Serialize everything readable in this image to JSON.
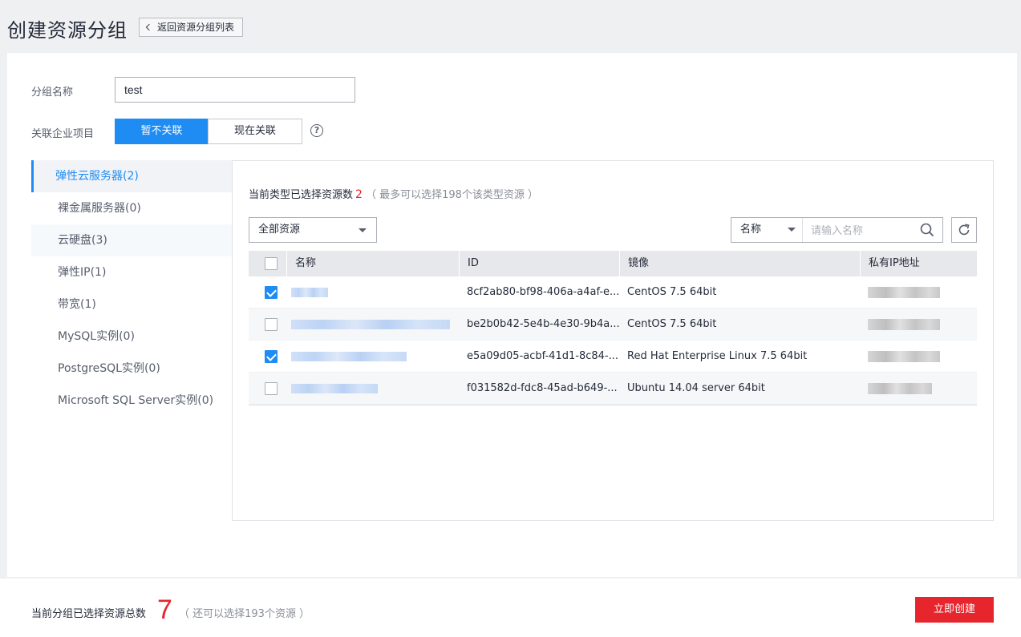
{
  "header": {
    "title": "创建资源分组",
    "back_label": "返回资源分组列表"
  },
  "form": {
    "group_name_label": "分组名称",
    "group_name_value": "test",
    "project_label": "关联企业项目",
    "project_options": [
      "暂不关联",
      "现在关联"
    ],
    "project_selected": "暂不关联"
  },
  "sidebar": {
    "items": [
      {
        "label": "弹性云服务器(2)",
        "active": true
      },
      {
        "label": "裸金属服务器(0)"
      },
      {
        "label": "云硬盘(3)"
      },
      {
        "label": "弹性IP(1)"
      },
      {
        "label": "带宽(1)"
      },
      {
        "label": "MySQL实例(0)"
      },
      {
        "label": "PostgreSQL实例(0)"
      },
      {
        "label": "Microsoft SQL Server实例(0)"
      }
    ]
  },
  "resources": {
    "count_label": "当前类型已选择资源数",
    "count_value": "2",
    "count_hint": "（ 最多可以选择198个该类型资源 ）",
    "filter_value": "全部资源",
    "search_field": "名称",
    "search_placeholder": "请输入名称",
    "columns": [
      "名称",
      "ID",
      "镜像",
      "私有IP地址"
    ],
    "rows": [
      {
        "checked": true,
        "id": "8cf2ab80-bf98-406a-a4af-e...",
        "image": "CentOS 7.5 64bit"
      },
      {
        "checked": false,
        "id": "be2b0b42-5e4b-4e30-9b4a...",
        "image": "CentOS 7.5 64bit"
      },
      {
        "checked": true,
        "id": "e5a09d05-acbf-41d1-8c84-...",
        "image": "Red Hat Enterprise Linux 7.5 64bit"
      },
      {
        "checked": false,
        "id": "f031582d-fdc8-45ad-b649-...",
        "image": "Ubuntu 14.04 server 64bit"
      }
    ]
  },
  "footer": {
    "total_label": "当前分组已选择资源总数",
    "total_value": "7",
    "total_hint": "（ 还可以选择193个资源 ）",
    "create_label": "立即创建"
  },
  "colors": {
    "primary": "#1f8cf3",
    "danger": "#e6262c"
  }
}
